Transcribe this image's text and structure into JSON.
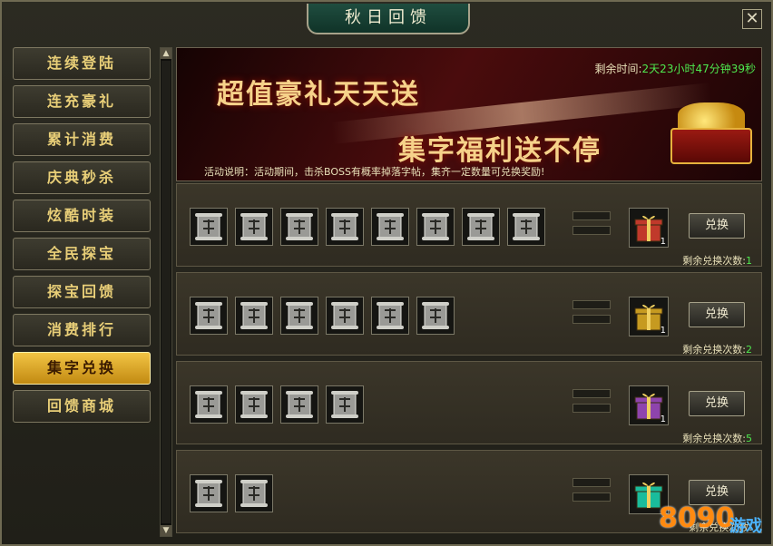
{
  "window": {
    "title": "秋日回馈",
    "close_label": "✕"
  },
  "sidebar": {
    "items": [
      {
        "label": "连续登陆",
        "active": false
      },
      {
        "label": "连充豪礼",
        "active": false
      },
      {
        "label": "累计消费",
        "active": false
      },
      {
        "label": "庆典秒杀",
        "active": false
      },
      {
        "label": "炫酷时装",
        "active": false
      },
      {
        "label": "全民探宝",
        "active": false
      },
      {
        "label": "探宝回馈",
        "active": false
      },
      {
        "label": "消费排行",
        "active": false
      },
      {
        "label": "集字兑换",
        "active": true
      },
      {
        "label": "回馈商城",
        "active": false
      }
    ]
  },
  "banner": {
    "slogan1": "超值豪礼天天送",
    "slogan2": "集字福利送不停",
    "timer_label": "剩余时间:",
    "timer_value": "2天23小时47分钟39秒",
    "description": "活动说明：活动期间，击杀BOSS有概率掉落字帖，集齐一定数量可兑换奖励!"
  },
  "rows": [
    {
      "pieces": 8,
      "gift_count": "1",
      "gift_color": "#c0392b",
      "button": "兑换",
      "remain_label": "剩余兑换次数:",
      "remain_value": "1"
    },
    {
      "pieces": 6,
      "gift_count": "1",
      "gift_color": "#c69a20",
      "button": "兑换",
      "remain_label": "剩余兑换次数:",
      "remain_value": "2"
    },
    {
      "pieces": 4,
      "gift_count": "1",
      "gift_color": "#8e44ad",
      "button": "兑换",
      "remain_label": "剩余兑换次数:",
      "remain_value": "5"
    },
    {
      "pieces": 2,
      "gift_count": "",
      "gift_color": "#1abc9c",
      "button": "兑换",
      "remain_label": "剩余兑换次数:",
      "remain_value": ""
    }
  ],
  "watermark": {
    "number": "8090",
    "text": "游戏"
  },
  "colors": {
    "accent_gold": "#f2c444",
    "green_text": "#4ee84e"
  }
}
